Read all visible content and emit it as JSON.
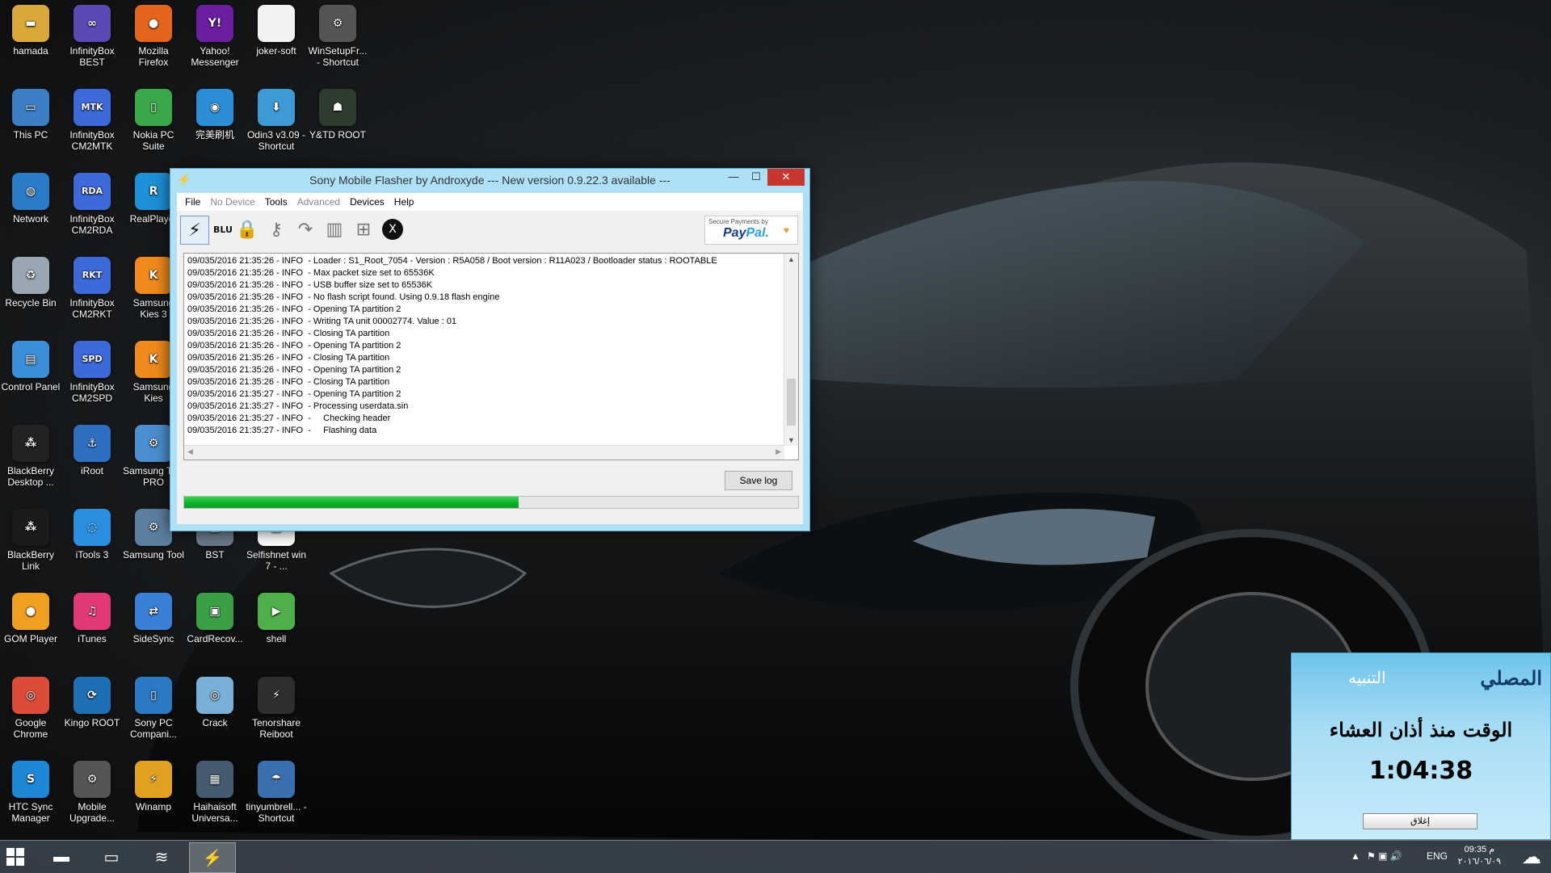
{
  "desktop": {
    "icons": [
      {
        "label": "hamada",
        "name": "folder-icon",
        "color": "#d9a83a",
        "glyph": "▬"
      },
      {
        "label": "InfinityBox BEST",
        "name": "infinitybox-icon",
        "color": "#5a4ab3",
        "glyph": "∞"
      },
      {
        "label": "Mozilla Firefox",
        "name": "firefox-icon",
        "color": "#e5641b",
        "glyph": "●"
      },
      {
        "label": "Yahoo! Messenger",
        "name": "yahoo-icon",
        "color": "#6b1fa0",
        "glyph": "Y!"
      },
      {
        "label": "joker-soft",
        "name": "file-icon",
        "color": "#f2f2f2",
        "glyph": ""
      },
      {
        "label": "WinSetupFr... - Shortcut",
        "name": "usb-icon",
        "color": "#555555",
        "glyph": "⚙"
      },
      {
        "label": "This PC",
        "name": "computer-icon",
        "color": "#3d7fc4",
        "glyph": "▭"
      },
      {
        "label": "InfinityBox CM2MTK",
        "name": "infinitybox-mtk-icon",
        "color": "#3d6ad8",
        "glyph": "MTK"
      },
      {
        "label": "Nokia PC Suite",
        "name": "nokia-icon",
        "color": "#3aa84a",
        "glyph": "▯"
      },
      {
        "label": "完美刷机",
        "name": "flash-tool-icon",
        "color": "#2a8fd6",
        "glyph": "◉"
      },
      {
        "label": "Odin3 v3.09 - Shortcut",
        "name": "odin-icon",
        "color": "#3e9ad4",
        "glyph": "⬇"
      },
      {
        "label": "Y&TD ROOT",
        "name": "android-root-icon",
        "color": "#2e3b2f",
        "glyph": "☗"
      },
      {
        "label": "Network",
        "name": "network-icon",
        "color": "#2a7bc8",
        "glyph": "◍"
      },
      {
        "label": "InfinityBox CM2RDA",
        "name": "infinitybox-rda-icon",
        "color": "#3d6ad8",
        "glyph": "RDA"
      },
      {
        "label": "RealPlayer",
        "name": "realplayer-icon",
        "color": "#1e90d8",
        "glyph": "R"
      },
      {
        "label": "Recycle Bin",
        "name": "recycle-bin-icon",
        "color": "#9aa7b2",
        "glyph": "♻"
      },
      {
        "label": "InfinityBox CM2RKT",
        "name": "infinitybox-rkt-icon",
        "color": "#3d6ad8",
        "glyph": "RKT"
      },
      {
        "label": "Samsung Kies 3",
        "name": "kies3-icon",
        "color": "#f08a1c",
        "glyph": "K"
      },
      {
        "label": "Control Panel",
        "name": "control-panel-icon",
        "color": "#3b8fd9",
        "glyph": "▤"
      },
      {
        "label": "InfinityBox CM2SPD",
        "name": "infinitybox-spd-icon",
        "color": "#3d6ad8",
        "glyph": "SPD"
      },
      {
        "label": "Samsung Kies",
        "name": "kies-icon",
        "color": "#f08a1c",
        "glyph": "K"
      },
      {
        "label": "BlackBerry Desktop ...",
        "name": "blackberry-desktop-icon",
        "color": "#222222",
        "glyph": "⁂"
      },
      {
        "label": "iRoot",
        "name": "iroot-icon",
        "color": "#2e6fc2",
        "glyph": "⚓"
      },
      {
        "label": "Samsung Tool PRO",
        "name": "samsung-tool-pro-icon",
        "color": "#4b8fd0",
        "glyph": "⚙"
      },
      {
        "label": "BlackBerry Link",
        "name": "blackberry-link-icon",
        "color": "#1a1a1a",
        "glyph": "⁂"
      },
      {
        "label": "iTools 3",
        "name": "itools-icon",
        "color": "#2a8fe0",
        "glyph": "◌"
      },
      {
        "label": "Samsung Tool",
        "name": "samsung-tool-icon",
        "color": "#5c7fa0",
        "glyph": "⚙"
      },
      {
        "label": "BST",
        "name": "bst-icon",
        "color": "#6a7a8a",
        "glyph": "▦"
      },
      {
        "label": "Selfishnet win 7 - ...",
        "name": "selfishnet-icon",
        "color": "#ffffff",
        "glyph": "▥"
      },
      {
        "label": "GOM Player",
        "name": "gom-player-icon",
        "color": "#f0a020",
        "glyph": "●"
      },
      {
        "label": "iTunes",
        "name": "itunes-icon",
        "color": "#e23a78",
        "glyph": "♫"
      },
      {
        "label": "SideSync",
        "name": "sidesync-icon",
        "color": "#3a7fd8",
        "glyph": "⇄"
      },
      {
        "label": "CardRecov...",
        "name": "cardrecovery-icon",
        "color": "#3b9f46",
        "glyph": "▣"
      },
      {
        "label": "shell",
        "name": "shell-icon",
        "color": "#4fb04a",
        "glyph": "▶"
      },
      {
        "label": "Google Chrome",
        "name": "chrome-icon",
        "color": "#dd4b39",
        "glyph": "◎"
      },
      {
        "label": "Kingo ROOT",
        "name": "kingo-root-icon",
        "color": "#1f6fb5",
        "glyph": "⟳"
      },
      {
        "label": "Sony PC Compani...",
        "name": "sony-pc-companion-icon",
        "color": "#2b78c4",
        "glyph": "▯"
      },
      {
        "label": "Crack",
        "name": "crack-icon",
        "color": "#7ab0d8",
        "glyph": "◎"
      },
      {
        "label": "Tenorshare Reiboot",
        "name": "reiboot-icon",
        "color": "#2e2e2e",
        "glyph": "⚡"
      },
      {
        "label": "HTC Sync Manager",
        "name": "htc-sync-icon",
        "color": "#1e88d8",
        "glyph": "S"
      },
      {
        "label": "Mobile Upgrade...",
        "name": "mobile-upgrade-icon",
        "color": "#555555",
        "glyph": "⚙"
      },
      {
        "label": "Winamp",
        "name": "winamp-icon",
        "color": "#e0a020",
        "glyph": "⚡"
      },
      {
        "label": "Haihaisoft Universa...",
        "name": "haihaisoft-icon",
        "color": "#465a70",
        "glyph": "▦"
      },
      {
        "label": "tinyumbrell... - Shortcut",
        "name": "tinyumbrella-icon",
        "color": "#3a70b0",
        "glyph": "☂"
      }
    ]
  },
  "window": {
    "title": "Sony Mobile Flasher by Androxyde     --- New version 0.9.22.3 available ---",
    "app_glyph": "⚡",
    "minimize_glyph": "—",
    "maximize_glyph": "☐",
    "close_glyph": "✕",
    "menu": [
      {
        "label": "File",
        "enabled": true
      },
      {
        "label": "No Device",
        "enabled": false
      },
      {
        "label": "Tools",
        "enabled": true
      },
      {
        "label": "Advanced",
        "enabled": false
      },
      {
        "label": "Devices",
        "enabled": true
      },
      {
        "label": "Help",
        "enabled": true
      }
    ],
    "toolbar": {
      "flash_glyph": "⚡",
      "blu_label": "BLU",
      "lock_glyph": "🔒",
      "key_glyph": "⚷",
      "arrow_glyph": "↷",
      "trash_glyph": "▥",
      "plus_glyph": "⊞",
      "xperia_glyph": "X",
      "paypal_secure": "Secure Payments by",
      "paypal_pay": "Pay",
      "paypal_pal": "Pal.",
      "paypal_heart": "♥"
    },
    "log_lines": [
      "09/035/2016 21:35:26 - INFO  - Loader : S1_Root_7054 - Version : R5A058 / Boot version : R11A023 / Bootloader status : ROOTABLE",
      "09/035/2016 21:35:26 - INFO  - Max packet size set to 65536K",
      "09/035/2016 21:35:26 - INFO  - USB buffer size set to 65536K",
      "09/035/2016 21:35:26 - INFO  - No flash script found. Using 0.9.18 flash engine",
      "09/035/2016 21:35:26 - INFO  - Opening TA partition 2",
      "09/035/2016 21:35:26 - INFO  - Writing TA unit 00002774. Value : 01",
      "09/035/2016 21:35:26 - INFO  - Closing TA partition",
      "09/035/2016 21:35:26 - INFO  - Opening TA partition 2",
      "09/035/2016 21:35:26 - INFO  - Closing TA partition",
      "09/035/2016 21:35:26 - INFO  - Opening TA partition 2",
      "09/035/2016 21:35:26 - INFO  - Closing TA partition",
      "09/035/2016 21:35:27 - INFO  - Opening TA partition 2",
      "09/035/2016 21:35:27 - INFO  - Processing userdata.sin",
      "09/035/2016 21:35:27 - INFO  -     Checking header",
      "09/035/2016 21:35:27 - INFO  -     Flashing data"
    ],
    "save_log_label": "Save log",
    "progress_fraction": 0.545,
    "progress_color": "#06b025"
  },
  "prayer_widget": {
    "logo": "المصلي",
    "alert_title": "التنبيه",
    "message": "الوقت منذ أذان العشاء",
    "elapsed": "1:04:38",
    "close_label": "إغلاق"
  },
  "taskbar": {
    "items": [
      {
        "name": "taskbar-explorer-icon",
        "glyph": "▬",
        "active": false
      },
      {
        "name": "taskbar-computer-icon",
        "glyph": "▭",
        "active": false
      },
      {
        "name": "taskbar-app-icon",
        "glyph": "≋",
        "active": false
      },
      {
        "name": "taskbar-flasher-icon",
        "glyph": "⚡",
        "active": true
      }
    ],
    "tray_up_glyph": "▲",
    "tray_icons": "⚑ ▣ 🔊",
    "language": "ENG",
    "time": "09:35 م",
    "date": "٢٠١٦/٠٦/٠٩",
    "weather_glyph": "☁"
  }
}
